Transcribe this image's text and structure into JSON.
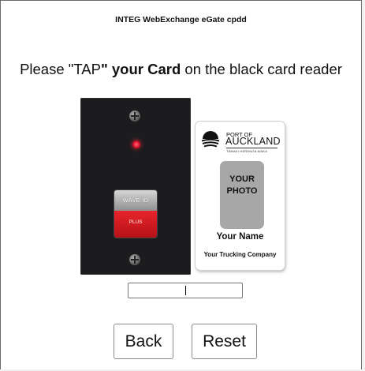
{
  "window": {
    "title": "INTEG WebExchange eGate cpdd"
  },
  "instruction": {
    "part1": "Please \"TAP",
    "part2": "\" ",
    "bold": "your Card",
    "part3": " on the black card reader"
  },
  "reader": {
    "brand_label": "WAVE ID",
    "model_label": "PLUS",
    "led_color": "#e0102a"
  },
  "card": {
    "org_line1": "PORT OF",
    "org_line2": "AUCKLAND",
    "org_tagline": "TĀMAKI HERENGA WAKA",
    "photo_line1": "YOUR",
    "photo_line2": "PHOTO",
    "name": "Your Name",
    "company": "Your Trucking Company"
  },
  "input": {
    "value": "",
    "placeholder": ""
  },
  "buttons": {
    "back_label": "Back",
    "reset_label": "Reset"
  }
}
